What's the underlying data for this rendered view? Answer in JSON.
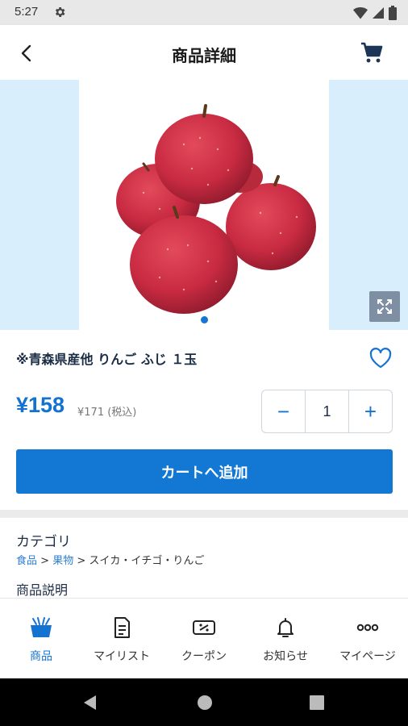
{
  "status_bar": {
    "time": "5:27"
  },
  "header": {
    "title": "商品詳細"
  },
  "product": {
    "name": "※青森県産他 りんご ふじ １玉",
    "price": "¥158",
    "price_tax_included": "¥171 (税込)",
    "quantity": "1",
    "minus_label": "−",
    "plus_label": "+",
    "add_to_cart_label": "カートへ追加",
    "image_count": 1,
    "current_image": 1
  },
  "category": {
    "title": "カテゴリ",
    "crumbs": [
      "食品",
      "果物",
      "スイカ・イチゴ・りんご"
    ],
    "separator": " > "
  },
  "description": {
    "title": "商品説明"
  },
  "bottom_nav": [
    {
      "label": "商品",
      "icon": "shopping-basket-icon",
      "active": true
    },
    {
      "label": "マイリスト",
      "icon": "list-icon",
      "active": false
    },
    {
      "label": "クーポン",
      "icon": "coupon-icon",
      "active": false
    },
    {
      "label": "お知らせ",
      "icon": "bell-icon",
      "active": false
    },
    {
      "label": "マイページ",
      "icon": "more-dots-icon",
      "active": false
    }
  ],
  "colors": {
    "accent": "#1473d0",
    "carousel_background": "#d8eefc",
    "expand_button": "#7e8fa3"
  }
}
